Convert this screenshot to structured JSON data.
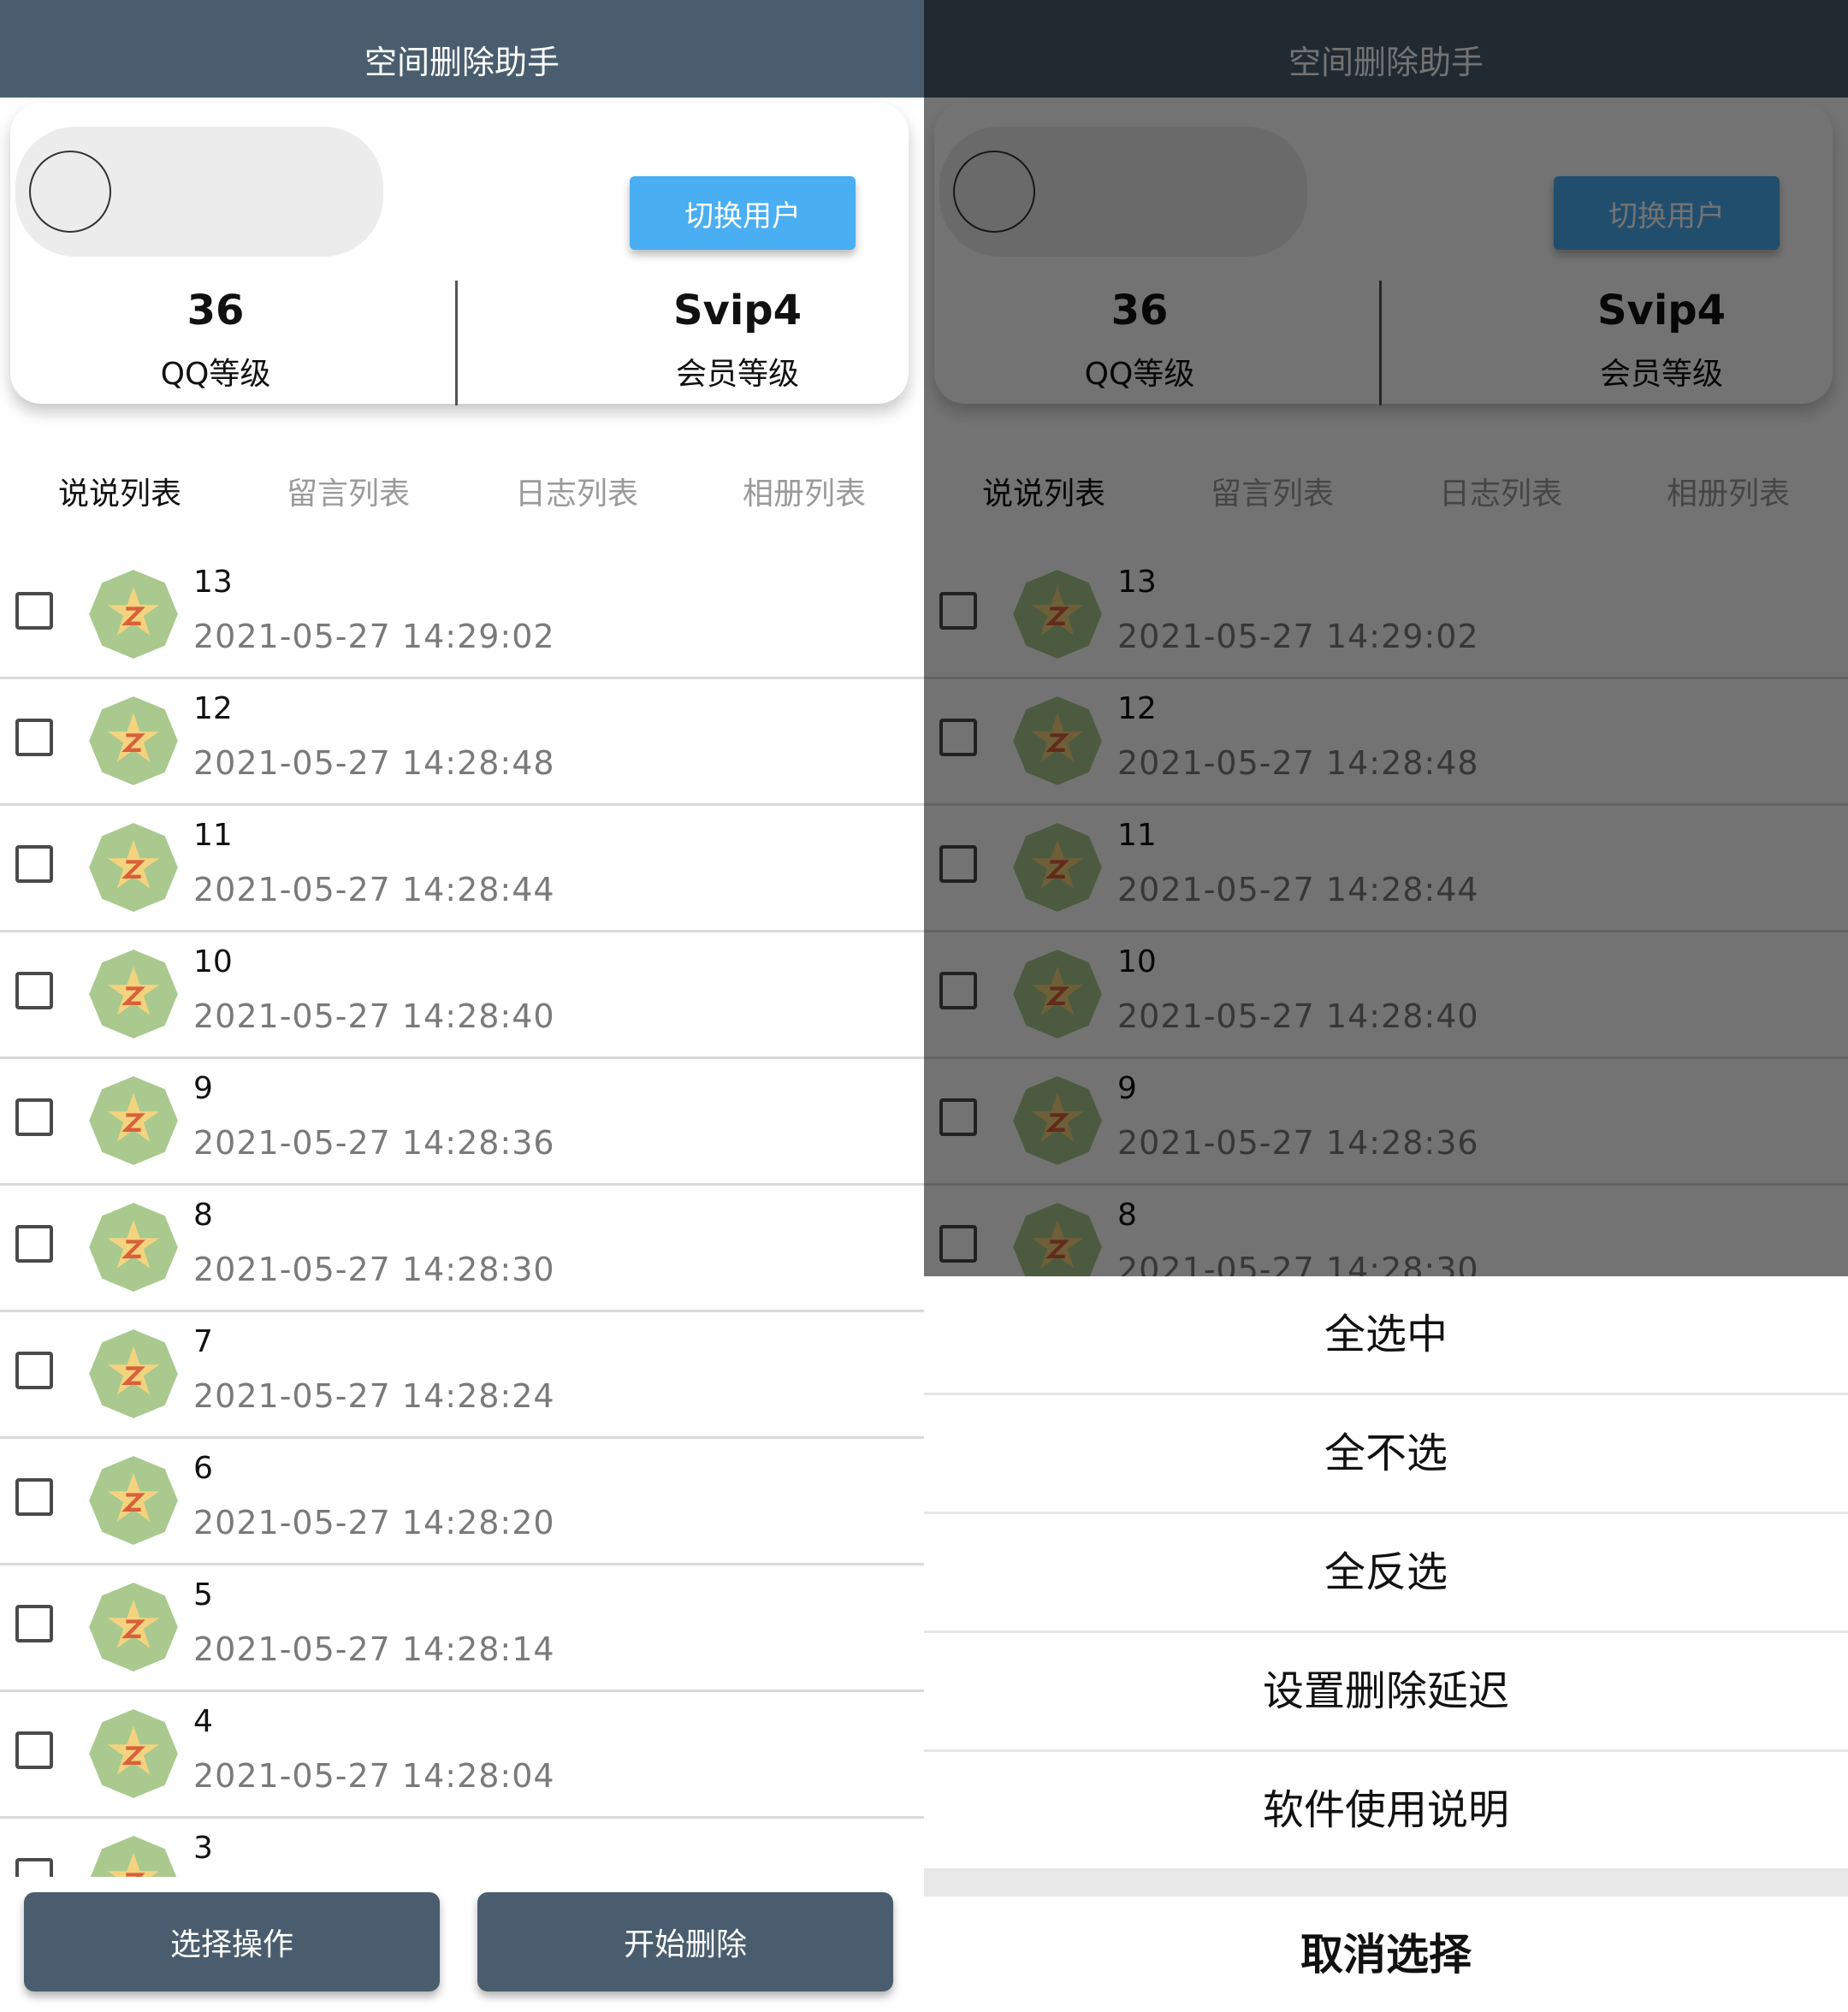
{
  "header": {
    "title": "空间删除助手"
  },
  "profile": {
    "switch_label": "切换用户",
    "qq_level": "36",
    "qq_level_label": "QQ等级",
    "vip_level": "Svip4",
    "vip_level_label": "会员等级"
  },
  "tabs": [
    {
      "label": "说说列表"
    },
    {
      "label": "留言列表"
    },
    {
      "label": "日志列表"
    },
    {
      "label": "相册列表"
    }
  ],
  "posts": [
    {
      "title": "13",
      "time": "2021-05-27 14:29:02"
    },
    {
      "title": "12",
      "time": "2021-05-27 14:28:48"
    },
    {
      "title": "11",
      "time": "2021-05-27 14:28:44"
    },
    {
      "title": "10",
      "time": "2021-05-27 14:28:40"
    },
    {
      "title": "9",
      "time": "2021-05-27 14:28:36"
    },
    {
      "title": "8",
      "time": "2021-05-27 14:28:30"
    },
    {
      "title": "7",
      "time": "2021-05-27 14:28:24"
    },
    {
      "title": "6",
      "time": "2021-05-27 14:28:20"
    },
    {
      "title": "5",
      "time": "2021-05-27 14:28:14"
    },
    {
      "title": "4",
      "time": "2021-05-27 14:28:04"
    },
    {
      "title": "3",
      "time": ""
    }
  ],
  "bottom": {
    "select_ops": "选择操作",
    "start_delete": "开始删除"
  },
  "action_sheet": {
    "items": [
      "全选中",
      "全不选",
      "全反选",
      "设置删除延迟",
      "软件使用说明"
    ],
    "cancel": "取消选择"
  },
  "colors": {
    "topbar": "#4a5d6e",
    "accent": "#49aef2",
    "badge_green": "#a9c98e"
  }
}
